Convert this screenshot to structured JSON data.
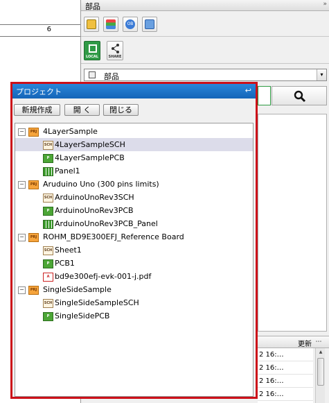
{
  "editor": {
    "ruler_number": "6"
  },
  "parts": {
    "title": "部品",
    "expand_icon": "»",
    "toolbar_icons": [
      "parts-library-icon",
      "layers-icon",
      "ob-icon",
      "db-icon"
    ],
    "local_label": "LOCAL",
    "share_label": "SHARE",
    "combo_value": "部品",
    "combo_arrow": "▾",
    "search_icon": "magnifier-icon",
    "grid": {
      "column_header": "更新",
      "menu_icon": "⋯",
      "rows": [
        "2 16:…",
        "2 16:…",
        "2 16:…",
        "2 16:…"
      ]
    }
  },
  "project": {
    "title": "プロジェクト",
    "pin_icon": "↩",
    "buttons": {
      "new": "新規作成",
      "open": "開 く",
      "close": "閉じる"
    },
    "tree": [
      {
        "level": 0,
        "type": "PRJ",
        "label": "4LayerSample",
        "expanded": true
      },
      {
        "level": 1,
        "type": "SCH",
        "label": "4LayerSampleSCH",
        "selected": true
      },
      {
        "level": 1,
        "type": "PCB",
        "label": "4LayerSamplePCB"
      },
      {
        "level": 1,
        "type": "PANEL",
        "label": "Panel1"
      },
      {
        "level": 0,
        "type": "PRJ",
        "label": "Aruduino Uno (300 pins limits)",
        "expanded": true
      },
      {
        "level": 1,
        "type": "SCH",
        "label": "ArduinoUnoRev3SCH"
      },
      {
        "level": 1,
        "type": "PCB",
        "label": "ArduinoUnoRev3PCB"
      },
      {
        "level": 1,
        "type": "PANEL",
        "label": "ArduinoUnoRev3PCB_Panel"
      },
      {
        "level": 0,
        "type": "PRJ",
        "label": "ROHM_BD9E300EFJ_Reference Board",
        "expanded": true
      },
      {
        "level": 1,
        "type": "SCH",
        "label": "Sheet1"
      },
      {
        "level": 1,
        "type": "PCB",
        "label": "PCB1"
      },
      {
        "level": 1,
        "type": "PDF",
        "label": "bd9e300efj-evk-001-j.pdf"
      },
      {
        "level": 0,
        "type": "PRJ",
        "label": "SingleSideSample",
        "expanded": true
      },
      {
        "level": 1,
        "type": "SCH",
        "label": "SingleSideSampleSCH"
      },
      {
        "level": 1,
        "type": "PCB",
        "label": "SingleSidePCB"
      }
    ]
  },
  "colors": {
    "accent": "#1a6fc4",
    "highlight_border": "#cc1019",
    "selection": "#dcdcea"
  }
}
